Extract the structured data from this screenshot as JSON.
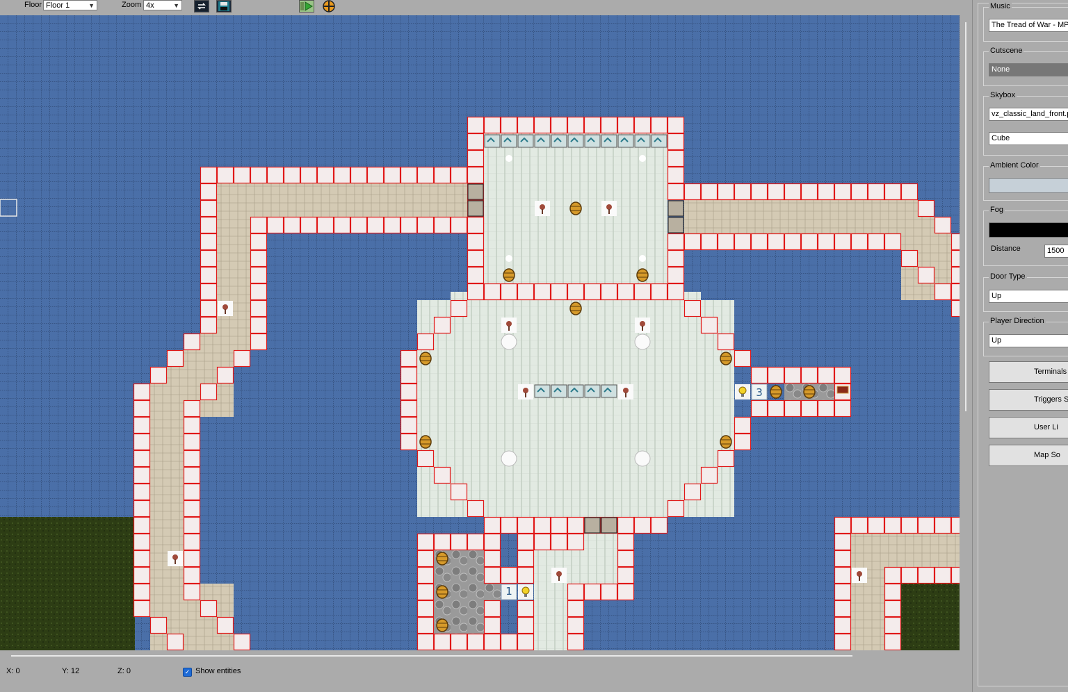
{
  "toolbar": {
    "floor_label": "Floor",
    "floor_value": "Floor 1",
    "zoom_label": "Zoom",
    "zoom_value": "4x"
  },
  "status": {
    "x": "X: 0",
    "y": "Y: 12",
    "z": "Z: 0",
    "show_entities": "Show entities"
  },
  "panel": {
    "music_label": "Music",
    "music_value": "The Tread of War - MP",
    "cutscene_label": "Cutscene",
    "cutscene_value": "None",
    "skybox_label": "Skybox",
    "skybox_value": "vz_classic_land_front.p",
    "skybox_mode": "Cube",
    "ambient_label": "Ambient Color",
    "ambient_color": "#c6d0d8",
    "fog_label": "Fog",
    "fog_color": "#000000",
    "distance_label": "Distance",
    "distance_value": "1500",
    "door_type_label": "Door Type",
    "door_type_value": "Up",
    "player_dir_label": "Player Direction",
    "player_dir_value": "Up",
    "btn_terminals": "Terminals S",
    "btn_triggers": "Triggers S",
    "btn_user": "User Li",
    "btn_mapso": "Map So"
  },
  "map": {
    "numbers": [
      "1",
      "3"
    ],
    "colors": {
      "water": "#4a6fa8",
      "grass": "#2d3d14",
      "wall_fill": "#f4ecec",
      "wall_border": "#e01818",
      "stone_floor": "#d4cab4",
      "tile_floor": "#dde6dd"
    }
  }
}
